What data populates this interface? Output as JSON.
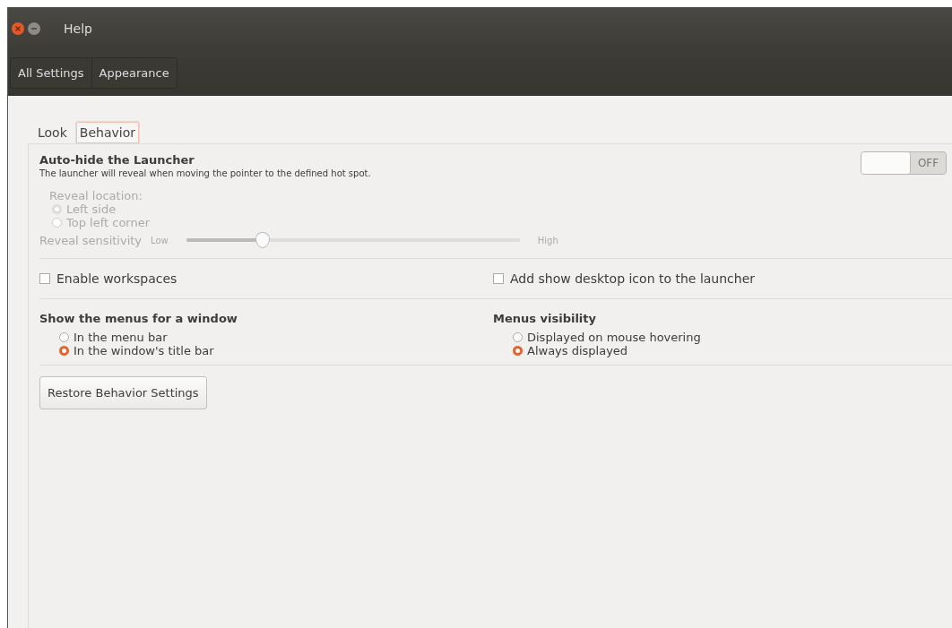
{
  "window": {
    "title": "Help"
  },
  "breadcrumbs": [
    {
      "label": "All Settings"
    },
    {
      "label": "Appearance"
    }
  ],
  "tabs": [
    {
      "label": "Look",
      "selected": false
    },
    {
      "label": "Behavior",
      "selected": true
    }
  ],
  "auto_hide": {
    "title": "Auto-hide the Launcher",
    "description": "The launcher will reveal when moving the pointer to the defined hot spot.",
    "switch": {
      "on": false,
      "label": "OFF"
    },
    "reveal": {
      "disabled": true,
      "label": "Reveal location:",
      "options": [
        {
          "label": "Left side",
          "selected": true
        },
        {
          "label": "Top left corner",
          "selected": false
        }
      ],
      "sensitivity": {
        "label": "Reveal sensitivity",
        "low": "Low",
        "high": "High",
        "level": 0.23
      }
    }
  },
  "checkboxes": [
    {
      "label": "Enable workspaces",
      "checked": false
    },
    {
      "label": "Add show desktop icon to the launcher",
      "checked": false
    }
  ],
  "radio_groups": [
    {
      "title": "Show the menus for a window",
      "options": [
        {
          "label": "In the menu bar",
          "selected": false
        },
        {
          "label": "In the window's title bar",
          "selected": true
        }
      ]
    },
    {
      "title": "Menus visibility",
      "options": [
        {
          "label": "Displayed on mouse hovering",
          "selected": false
        },
        {
          "label": "Always displayed",
          "selected": true
        }
      ]
    }
  ],
  "restore_button": {
    "label": "Restore Behavior Settings"
  }
}
